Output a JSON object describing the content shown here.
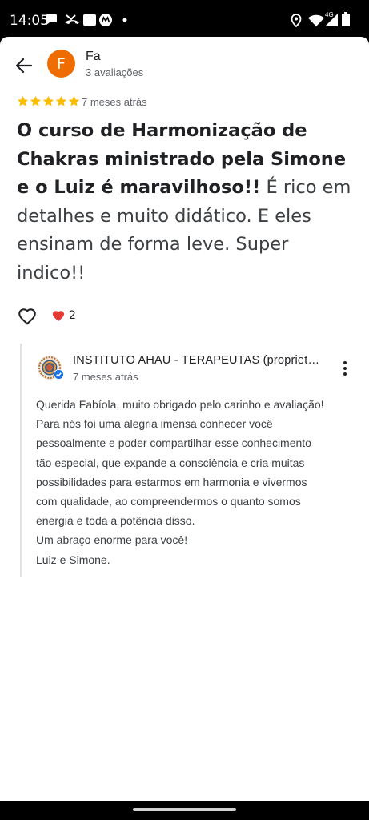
{
  "status_bar": {
    "time": "14:05",
    "network_label": "4G",
    "left_icons": [
      "message-icon",
      "missed-call-icon",
      "app-square-icon",
      "motorola-icon",
      "notification-dot-icon"
    ],
    "right_icons": [
      "location-icon",
      "wifi-icon",
      "cell-signal-icon",
      "battery-icon"
    ]
  },
  "header": {
    "back_icon": "arrow-back-icon",
    "avatar_letter": "F",
    "avatar_color": "#ef6c00",
    "reviewer_name": "Fa",
    "review_count": "3 avaliações"
  },
  "review": {
    "rating": 5,
    "star_color": "#fbbc04",
    "time": "7 meses atrás",
    "text_bold": "O curso de Harmonização de Chakras ministrado pela Simone e o Luiz é maravilhoso!!",
    "text_rest": " É rico em detalhes e muito didático. E eles ensinam de forma leve. Super indico!!",
    "like_icon": "heart-outline-icon",
    "reaction_icon": "red-heart-icon",
    "reaction_color": "#e53935",
    "reaction_count": "2"
  },
  "owner_response": {
    "name": "INSTITUTO AHAU - TERAPEUTAS (proprietário)",
    "time": "7 meses atrás",
    "verified_icon": "verified-badge-icon",
    "verified_color": "#1a73e8",
    "menu_icon": "more-vert-icon",
    "reply_lines": [
      "Querida Fabíola, muito obrigado pelo carinho e avaliação!",
      "Para nós foi uma alegria imensa conhecer você",
      "pessoalmente e poder compartilhar esse conhecimento",
      "tão especial, que expande a consciência e cria muitas",
      "possibilidades para estarmos em harmonia e vivermos",
      "com qualidade, ao compreendermos o quanto somos",
      "energia e toda a potência disso.",
      "Um abraço enorme para você!",
      "Luiz e Simone."
    ]
  },
  "nav": {
    "handle": "gesture-nav-handle"
  }
}
